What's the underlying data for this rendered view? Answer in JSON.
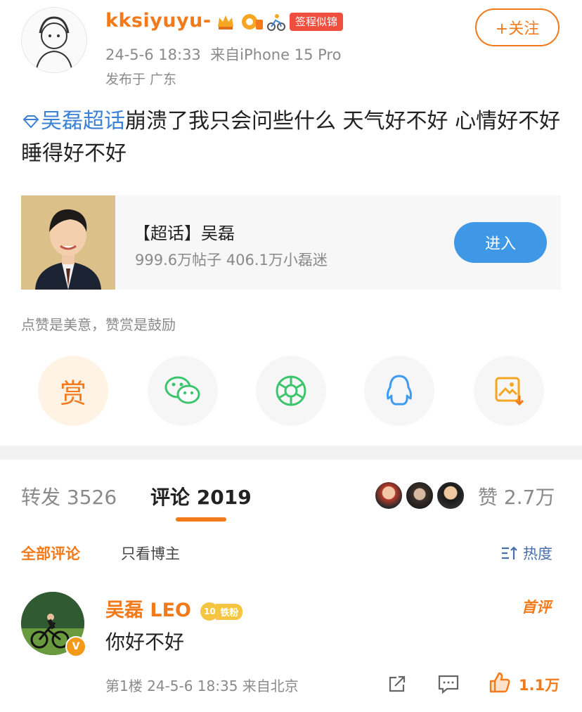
{
  "post": {
    "author": "kksiyuyu-",
    "badge_tag": "签程似锦",
    "time": "24-5-6 18:33",
    "source": "来自iPhone 15 Pro",
    "region": "发布于 广东",
    "follow_label": "+关注",
    "topic_link": "吴磊超话",
    "text": "崩溃了我只会问些什么 天气好不好 心情好不好 睡得好不好"
  },
  "supertopic_card": {
    "title": "【超话】吴磊",
    "stats": "999.6万帖子 406.1万小磊迷",
    "enter_label": "进入"
  },
  "share": {
    "hint": "点赞是美意，赞赏是鼓励",
    "reward_label": "赏",
    "items": [
      "reward-icon",
      "wechat-icon",
      "moments-icon",
      "qq-icon",
      "save-image-icon"
    ]
  },
  "tabs": {
    "repost_label": "转发",
    "repost_count": "3526",
    "comment_label": "评论",
    "comment_count": "2019",
    "like_label": "赞",
    "like_count": "2.7万"
  },
  "filters": {
    "all": "全部评论",
    "owner_only": "只看博主",
    "sort": "热度"
  },
  "comment": {
    "name": "吴磊 LEO",
    "level": "10",
    "level_tag": "铁粉",
    "first_tag": "首评",
    "text": "你好不好",
    "floor": "第1楼",
    "time": "24-5-6 18:35",
    "location": "来自北京",
    "like_count": "1.1万"
  },
  "colors": {
    "accent": "#f27a1a",
    "link": "#3b82d6",
    "enter_button": "#3f98e6",
    "wechat": "#3ec46d",
    "qq": "#3f9bf0",
    "gray_text": "#8a8a8a"
  }
}
